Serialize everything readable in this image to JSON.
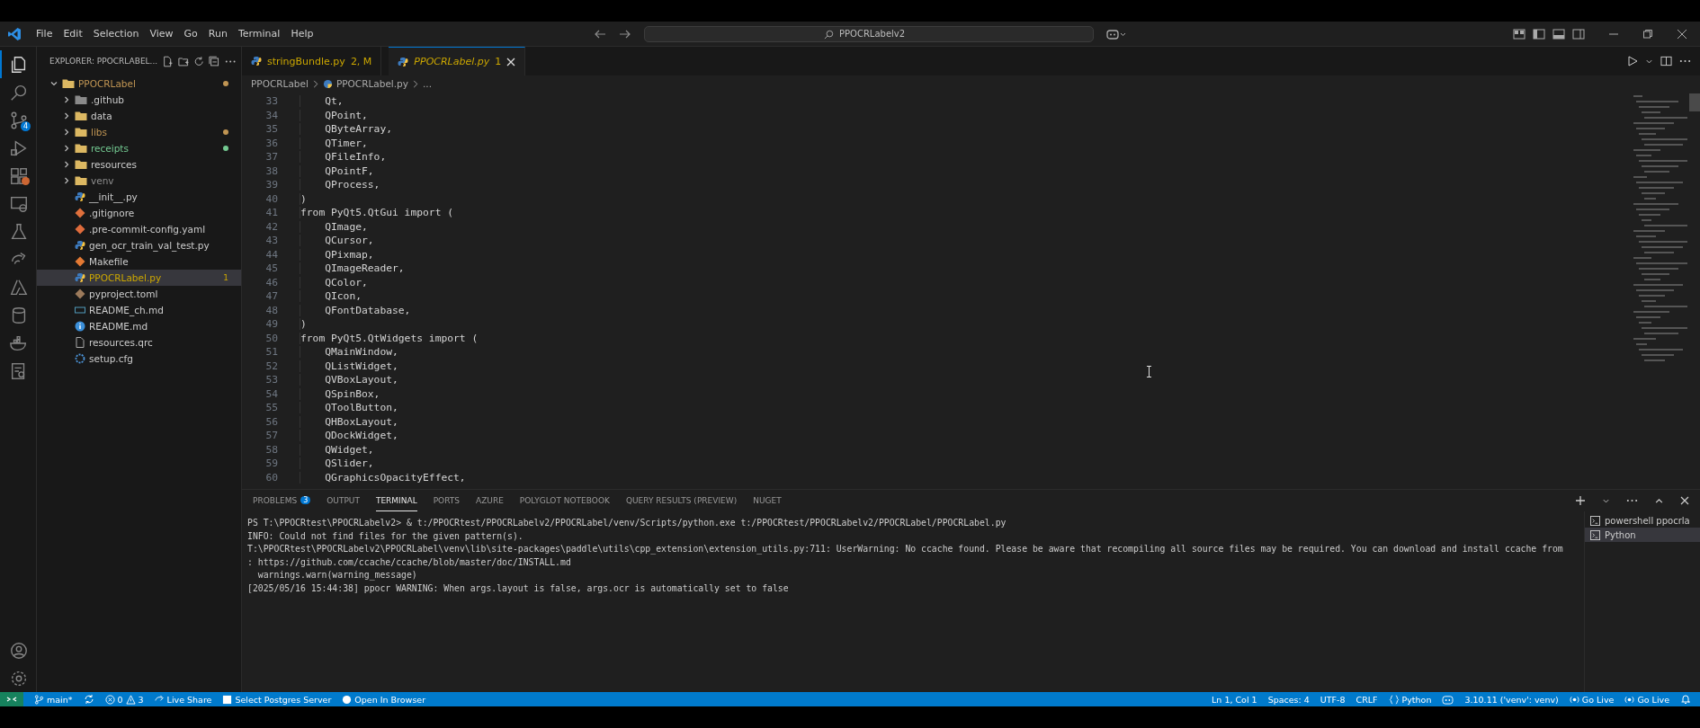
{
  "menu": [
    "File",
    "Edit",
    "Selection",
    "View",
    "Go",
    "Run",
    "Terminal",
    "Help"
  ],
  "command_center": {
    "placeholder": "PPOCRLabelv2"
  },
  "activity_bar": [
    {
      "kind": "files",
      "selected": true
    },
    {
      "kind": "search",
      "selected": false
    },
    {
      "kind": "source-control",
      "selected": false,
      "badge": "4"
    },
    {
      "kind": "run",
      "selected": false
    },
    {
      "kind": "extensions",
      "selected": false,
      "alert": true
    },
    {
      "kind": "remote",
      "selected": false
    },
    {
      "kind": "flask",
      "selected": false
    },
    {
      "kind": "share",
      "selected": false
    },
    {
      "kind": "azure",
      "selected": false
    },
    {
      "kind": "database",
      "selected": false
    },
    {
      "kind": "whale",
      "selected": false
    },
    {
      "kind": "report",
      "selected": false
    }
  ],
  "activity_bottom": [
    {
      "kind": "account"
    },
    {
      "kind": "settings"
    }
  ],
  "explorer": {
    "title": "EXPLORER: PPOCRLABEL...",
    "tree": [
      {
        "name": "PPOCRLabel",
        "kind": "folder",
        "expanded": true,
        "color": "#c09553",
        "dot": true,
        "selected": false,
        "children": [
          {
            "name": ".github",
            "kind": "folder",
            "expanded": false,
            "color": "#cccccc",
            "selected": false
          },
          {
            "name": "data",
            "kind": "folder",
            "expanded": false,
            "color": "#cccccc",
            "selected": false
          },
          {
            "name": "libs",
            "kind": "folder",
            "expanded": false,
            "color": "#c09553",
            "dot": true,
            "selected": false
          },
          {
            "name": "receipts",
            "kind": "folder",
            "expanded": false,
            "color": "#73c991",
            "dot": true,
            "selected": false
          },
          {
            "name": "resources",
            "kind": "folder",
            "expanded": false,
            "color": "#cccccc",
            "selected": false
          },
          {
            "name": "venv",
            "kind": "folder",
            "expanded": false,
            "color": "#8c8c8c",
            "selected": false
          },
          {
            "name": "__init__.py",
            "kind": "python",
            "color": "#cccccc",
            "selected": false
          },
          {
            "name": ".gitignore",
            "kind": "git",
            "color": "#cccccc",
            "selected": false
          },
          {
            "name": ".pre-commit-config.yaml",
            "kind": "yaml",
            "color": "#cccccc",
            "selected": false
          },
          {
            "name": "gen_ocr_train_val_test.py",
            "kind": "python",
            "color": "#cccccc",
            "selected": false
          },
          {
            "name": "Makefile",
            "kind": "make",
            "color": "#cccccc",
            "selected": false
          },
          {
            "name": "PPOCRLabel.py",
            "kind": "python",
            "color": "#cca700",
            "badge": "1",
            "selected": true
          },
          {
            "name": "pyproject.toml",
            "kind": "toml",
            "color": "#cccccc",
            "selected": false
          },
          {
            "name": "README_ch.md",
            "kind": "markdown",
            "color": "#cccccc",
            "selected": false
          },
          {
            "name": "README.md",
            "kind": "info",
            "color": "#cccccc",
            "selected": false
          },
          {
            "name": "resources.qrc",
            "kind": "text",
            "color": "#cccccc",
            "selected": false
          },
          {
            "name": "setup.cfg",
            "kind": "config",
            "color": "#cccccc",
            "selected": false
          }
        ]
      }
    ]
  },
  "tabs": [
    {
      "name": "stringBundle.py",
      "status": "2, M",
      "selected": false,
      "color": "#cca700"
    },
    {
      "name": "PPOCRLabel.py",
      "status": "1",
      "selected": true,
      "color": "#cca700"
    }
  ],
  "breadcrumbs": [
    "PPOCRLabel",
    "PPOCRLabel.py",
    "..."
  ],
  "code": [
    {
      "number": "33",
      "text": "    Qt,"
    },
    {
      "number": "34",
      "text": "    QPoint,"
    },
    {
      "number": "35",
      "text": "    QByteArray,"
    },
    {
      "number": "36",
      "text": "    QTimer,"
    },
    {
      "number": "37",
      "text": "    QFileInfo,"
    },
    {
      "number": "38",
      "text": "    QPointF,"
    },
    {
      "number": "39",
      "text": "    QProcess,"
    },
    {
      "number": "40",
      "text": ")"
    },
    {
      "number": "41",
      "text": "from PyQt5.QtGui import ("
    },
    {
      "number": "42",
      "text": "    QImage,"
    },
    {
      "number": "43",
      "text": "    QCursor,"
    },
    {
      "number": "44",
      "text": "    QPixmap,"
    },
    {
      "number": "45",
      "text": "    QImageReader,"
    },
    {
      "number": "46",
      "text": "    QColor,"
    },
    {
      "number": "47",
      "text": "    QIcon,"
    },
    {
      "number": "48",
      "text": "    QFontDatabase,"
    },
    {
      "number": "49",
      "text": ")"
    },
    {
      "number": "50",
      "text": "from PyQt5.QtWidgets import ("
    },
    {
      "number": "51",
      "text": "    QMainWindow,"
    },
    {
      "number": "52",
      "text": "    QListWidget,"
    },
    {
      "number": "53",
      "text": "    QVBoxLayout,"
    },
    {
      "number": "54",
      "text": "    QSpinBox,"
    },
    {
      "number": "55",
      "text": "    QToolButton,"
    },
    {
      "number": "56",
      "text": "    QHBoxLayout,"
    },
    {
      "number": "57",
      "text": "    QDockWidget,"
    },
    {
      "number": "58",
      "text": "    QWidget,"
    },
    {
      "number": "59",
      "text": "    QSlider,"
    },
    {
      "number": "60",
      "text": "    QGraphicsOpacityEffect,"
    }
  ],
  "panel_tabs": [
    {
      "label": "PROBLEMS",
      "badge": "3",
      "selected": false
    },
    {
      "label": "OUTPUT",
      "selected": false
    },
    {
      "label": "TERMINAL",
      "selected": true
    },
    {
      "label": "PORTS",
      "selected": false
    },
    {
      "label": "AZURE",
      "selected": false
    },
    {
      "label": "POLYGLOT NOTEBOOK",
      "selected": false
    },
    {
      "label": "QUERY RESULTS (PREVIEW)",
      "selected": false
    },
    {
      "label": "NUGET",
      "selected": false
    }
  ],
  "terminal": [
    "PS T:\\PPOCRtest\\PPOCRLabelv2> & t:/PPOCRtest/PPOCRLabelv2/PPOCRLabel/venv/Scripts/python.exe t:/PPOCRtest/PPOCRLabelv2/PPOCRLabel/PPOCRLabel.py",
    "INFO: Could not find files for the given pattern(s).",
    "T:\\PPOCRtest\\PPOCRLabelv2\\PPOCRLabel\\venv\\lib\\site-packages\\paddle\\utils\\cpp_extension\\extension_utils.py:711: UserWarning: No ccache found. Please be aware that recompiling all source files may be required. You can download and install ccache from",
    ": https://github.com/ccache/ccache/blob/master/doc/INSTALL.md",
    "  warnings.warn(warning_message)",
    "[2025/05/16 15:44:38] ppocr WARNING: When args.layout is false, args.ocr is automatically set to false"
  ],
  "terminal_list": [
    {
      "name": "powershell ppocrla",
      "selected": false
    },
    {
      "name": "Python",
      "selected": true
    }
  ],
  "status_left": [
    {
      "kind": "branch",
      "text": "main*"
    },
    {
      "kind": "sync"
    },
    {
      "kind": "problems",
      "errors": "0",
      "warnings": "3"
    },
    {
      "kind": "share",
      "text": "Live Share"
    },
    {
      "kind": "db",
      "text": "Select Postgres Server"
    },
    {
      "kind": "globe",
      "text": "Open In Browser"
    }
  ],
  "status_right": [
    {
      "kind": "plain",
      "text": "Ln 1, Col 1"
    },
    {
      "kind": "plain",
      "text": "Spaces: 4"
    },
    {
      "kind": "plain",
      "text": "UTF-8"
    },
    {
      "kind": "plain",
      "text": "CRLF"
    },
    {
      "kind": "braces",
      "text": "Python"
    },
    {
      "kind": "copilot"
    },
    {
      "kind": "plain",
      "text": "3.10.11 ('venv': venv)"
    },
    {
      "kind": "radio",
      "text": "Go Live"
    },
    {
      "kind": "radio",
      "text": "Go Live"
    },
    {
      "kind": "bell"
    }
  ]
}
